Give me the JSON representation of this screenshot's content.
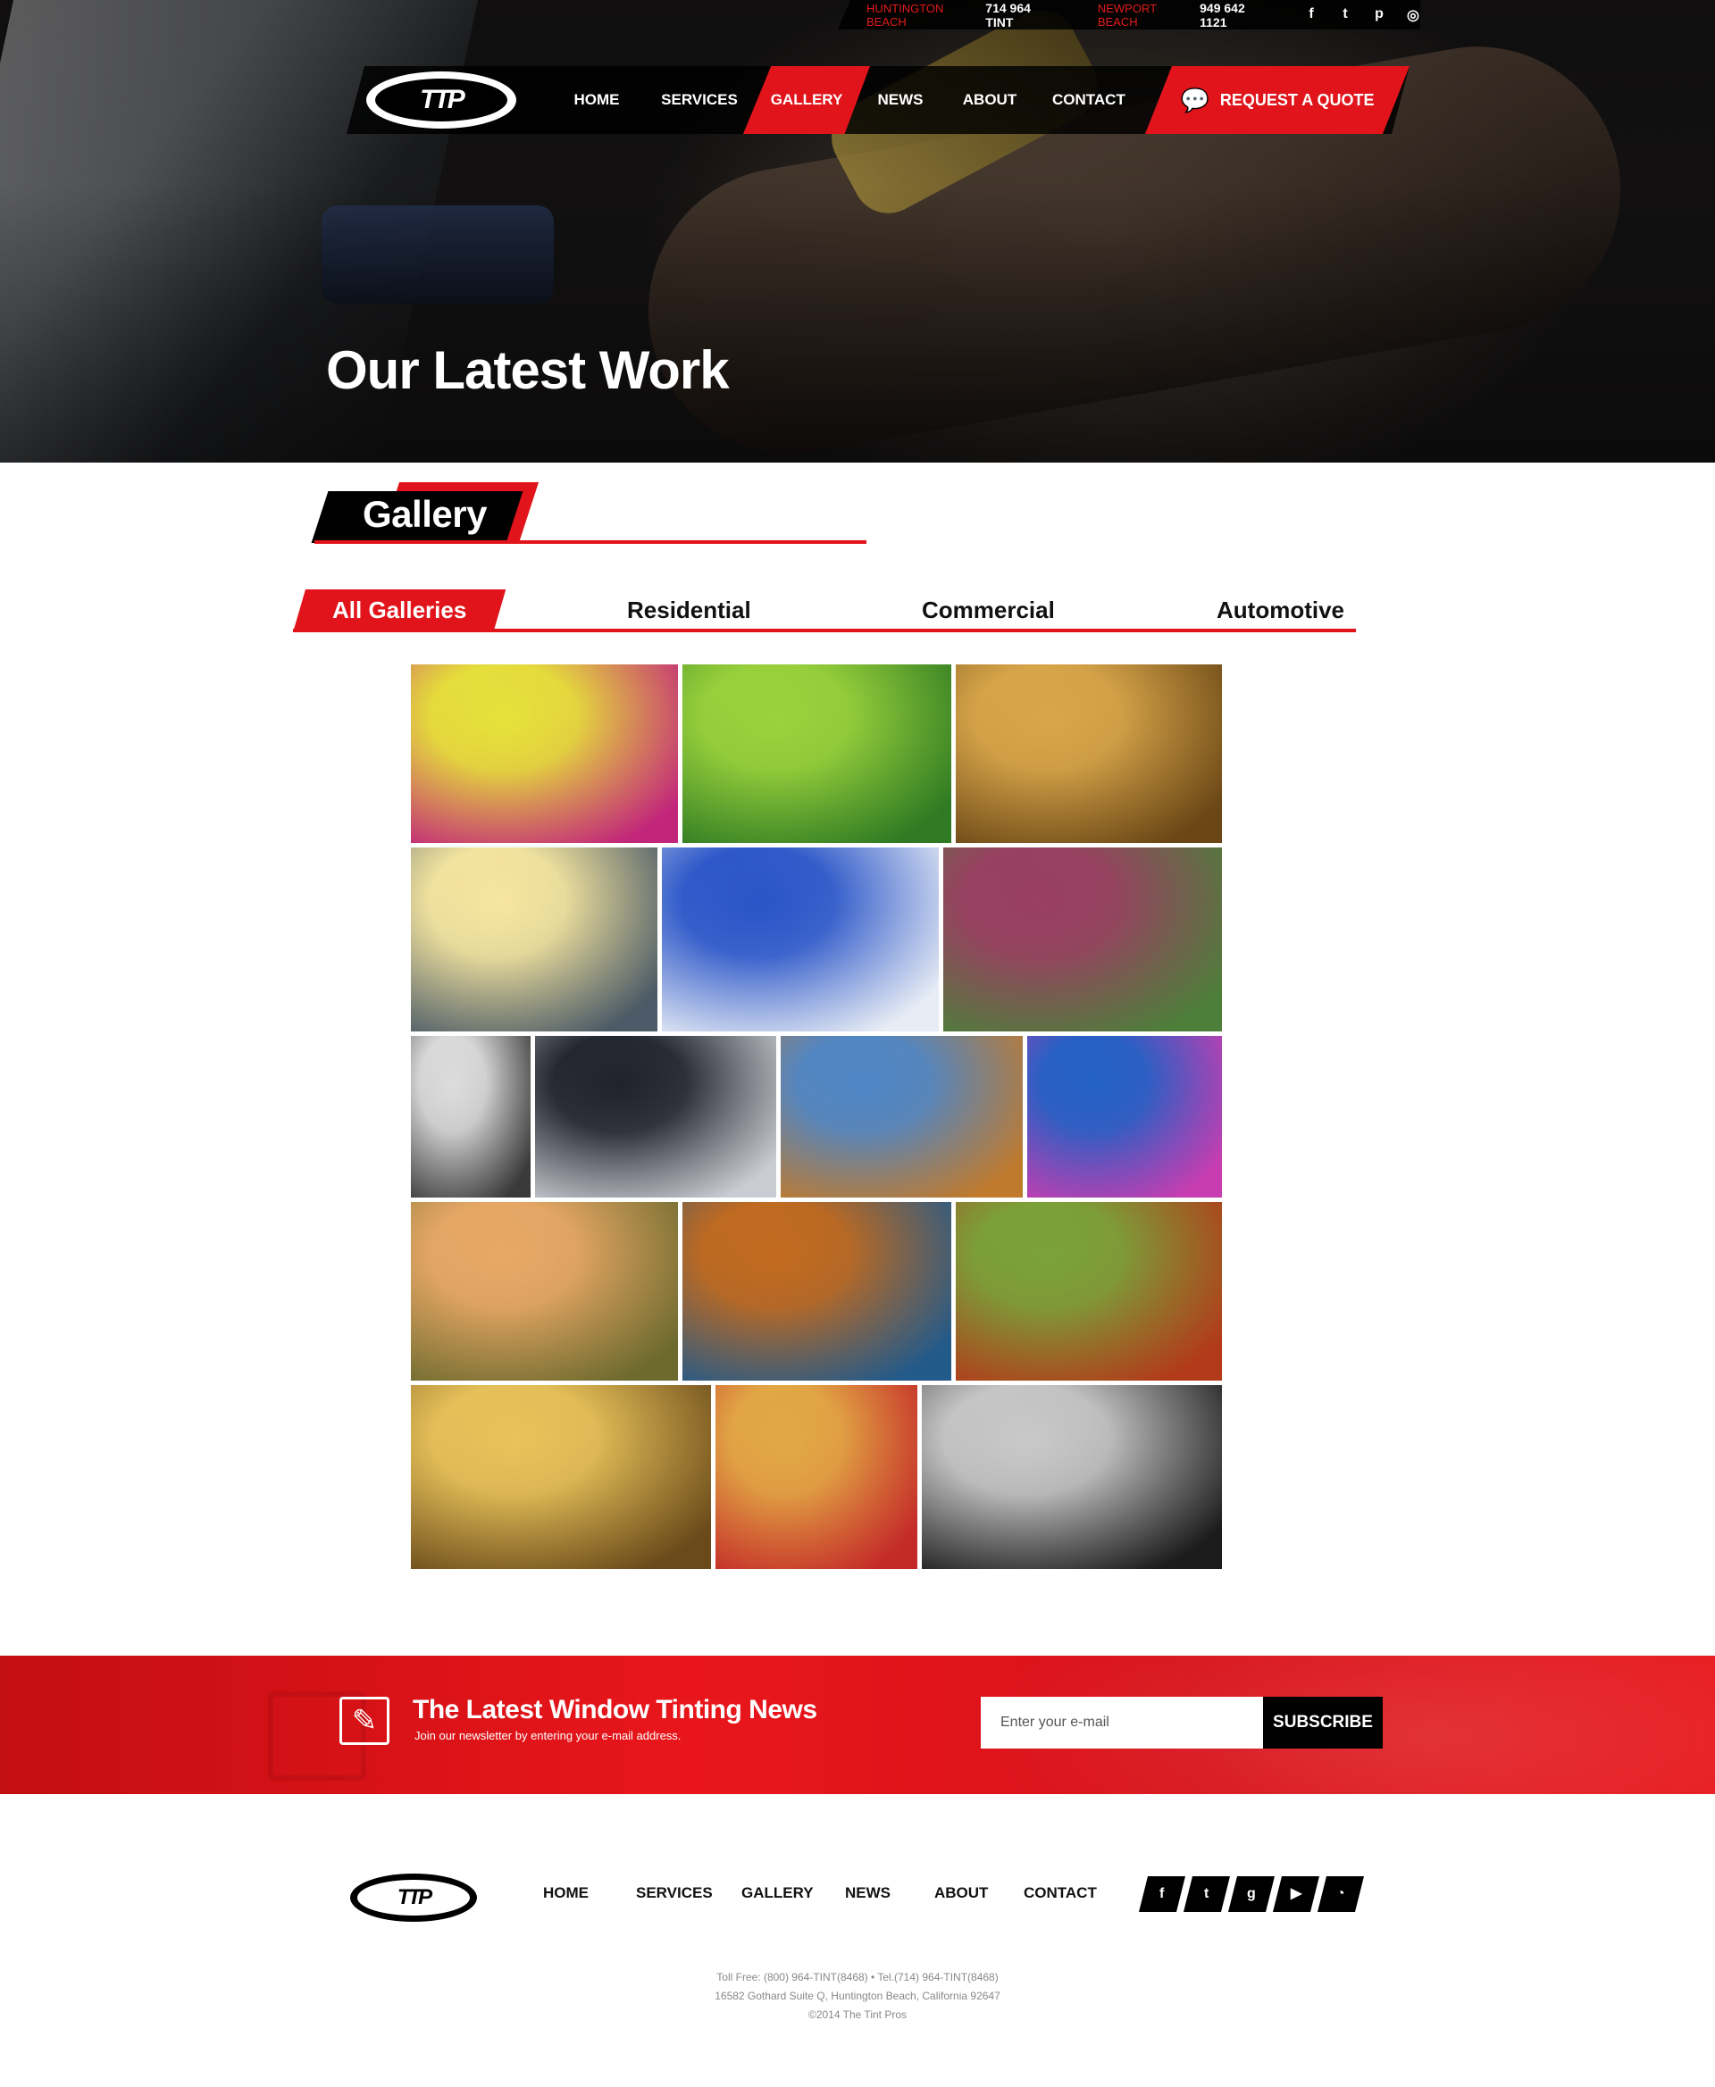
{
  "topbar": {
    "locations": [
      {
        "city": "HUNTINGTON BEACH",
        "phone": "714 964 TINT"
      },
      {
        "city": "NEWPORT BEACH",
        "phone": "949 642 1121"
      }
    ],
    "social": [
      {
        "icon": "facebook-icon",
        "glyph": "f"
      },
      {
        "icon": "twitter-icon",
        "glyph": "t"
      },
      {
        "icon": "pinterest-icon",
        "glyph": "p"
      },
      {
        "icon": "instagram-icon",
        "glyph": "◎"
      }
    ]
  },
  "brand": {
    "logo_text": "TTP"
  },
  "nav": {
    "items": [
      "HOME",
      "SERVICES",
      "GALLERY",
      "NEWS",
      "ABOUT",
      "CONTACT"
    ],
    "active": "GALLERY",
    "quote_label": "REQUEST A QUOTE"
  },
  "hero": {
    "title": "Our Latest Work"
  },
  "gallery": {
    "heading": "Gallery",
    "tabs": [
      "All Galleries",
      "Residential",
      "Commercial",
      "Automotive"
    ],
    "active_tab": "All Galleries",
    "tiles": [
      {
        "subject": "colored-hands",
        "colors": [
          "#e6e23a",
          "#c2267a"
        ]
      },
      {
        "subject": "rice-terraces",
        "colors": [
          "#9ad23c",
          "#2f7a23"
        ]
      },
      {
        "subject": "desert-dunes",
        "colors": [
          "#d8a64a",
          "#6b4716"
        ]
      },
      {
        "subject": "sunset-pier",
        "colors": [
          "#f6e6a0",
          "#4b5a66"
        ]
      },
      {
        "subject": "santorini-domes",
        "colors": [
          "#2a55c8",
          "#e8edf5"
        ]
      },
      {
        "subject": "mountain-river",
        "colors": [
          "#9a3f62",
          "#4d7e3a"
        ]
      },
      {
        "subject": "old-man-portrait",
        "colors": [
          "#dcdcdc",
          "#3a3a3a"
        ]
      },
      {
        "subject": "snowy-mountains",
        "colors": [
          "#20222c",
          "#c9ccd2"
        ]
      },
      {
        "subject": "tribal-children",
        "colors": [
          "#4f86c6",
          "#c07a2c"
        ]
      },
      {
        "subject": "blue-abstract",
        "colors": [
          "#2361c4",
          "#c83db0"
        ]
      },
      {
        "subject": "balloons-valley",
        "colors": [
          "#e8a866",
          "#6e6a2e"
        ]
      },
      {
        "subject": "autumn-lake",
        "colors": [
          "#c26a1e",
          "#225a8a"
        ]
      },
      {
        "subject": "monks-temple",
        "colors": [
          "#7aa23a",
          "#b23a1a"
        ]
      },
      {
        "subject": "forest-sunbeams",
        "colors": [
          "#e8c25a",
          "#6a4a1a"
        ]
      },
      {
        "subject": "decorated-elephant",
        "colors": [
          "#e2a845",
          "#c42a28"
        ]
      },
      {
        "subject": "rocky-shore",
        "colors": [
          "#c9c9c9",
          "#1c1c1c"
        ]
      }
    ]
  },
  "newsletter": {
    "title": "The Latest Window Tinting News",
    "subtitle": "Join our newsletter by entering your e-mail address.",
    "placeholder": "Enter your e-mail",
    "button": "SUBSCRIBE"
  },
  "footer": {
    "nav": [
      "HOME",
      "SERVICES",
      "GALLERY",
      "NEWS",
      "ABOUT",
      "CONTACT"
    ],
    "social": [
      {
        "icon": "facebook-icon",
        "glyph": "f"
      },
      {
        "icon": "twitter-icon",
        "glyph": "t"
      },
      {
        "icon": "google-plus-icon",
        "glyph": "g"
      },
      {
        "icon": "youtube-icon",
        "glyph": "▶"
      },
      {
        "icon": "rss-icon",
        "glyph": "◔"
      }
    ],
    "lines": [
      "Toll Free: (800) 964-TINT(8468) • Tel.(714) 964-TINT(8468)",
      "16582 Gothard Suite Q, Huntington Beach, California 92647",
      "©2014 The Tint Pros"
    ]
  },
  "colors": {
    "accent": "#e0141a",
    "dark": "#000000"
  }
}
